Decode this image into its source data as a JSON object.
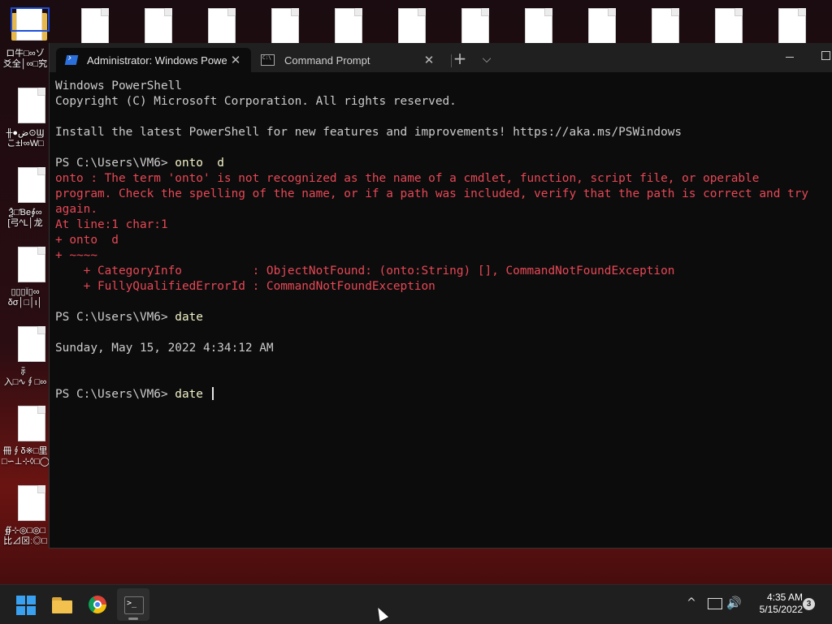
{
  "desktop": {
    "icons": [
      {
        "label_line1": "ロ牛□∞ゾ",
        "label_line2": "爻全│∞□究",
        "icon": "folder-icon"
      },
      {
        "label_line1": "╫●ض⊙Ϣ",
        "label_line2": "こ±ŀ∞W□",
        "icon": "file-icon"
      },
      {
        "label_line1": "Ѯ□Ɓе∮∞",
        "label_line2": "[弓^L│龙",
        "icon": "file-icon"
      },
      {
        "label_line1": "▯▯▯Ϊ▯∞",
        "label_line2": "δσ│□│ι│",
        "icon": "file-icon"
      },
      {
        "label_line1": "⺬",
        "label_line2": "入□∿∮□∞",
        "icon": "file-icon"
      },
      {
        "label_line1": "冊∮δ※□里",
        "label_line2": "□∽⊥⊹◊□◯",
        "icon": "file-icon"
      },
      {
        "label_line1": "∯⊹◎□◎□",
        "label_line2": "比⊿⊠ː◎□",
        "icon": "file-icon"
      }
    ]
  },
  "terminal": {
    "tabs": [
      {
        "title": "Administrator: Windows PowerShell",
        "icon": "powershell-icon",
        "active": true
      },
      {
        "title": "Command Prompt",
        "icon": "cmd-icon",
        "active": false
      }
    ],
    "close_glyph": "✕",
    "new_tab_glyph": "+",
    "dropdown_glyph": "⌵",
    "lines": [
      {
        "text": "Windows PowerShell",
        "style": "normal"
      },
      {
        "text": "Copyright (C) Microsoft Corporation. All rights reserved.",
        "style": "normal"
      },
      {
        "text": "",
        "style": "normal"
      },
      {
        "text": "Install the latest PowerShell for new features and improvements! https://aka.ms/PSWindows",
        "style": "normal"
      },
      {
        "text": "",
        "style": "normal"
      },
      {
        "prompt": "PS C:\\Users\\VM6> ",
        "command": "onto  d",
        "style": "prompt"
      },
      {
        "text": "onto : The term 'onto' is not recognized as the name of a cmdlet, function, script file, or operable",
        "style": "err"
      },
      {
        "text": "program. Check the spelling of the name, or if a path was included, verify that the path is correct and try",
        "style": "err"
      },
      {
        "text": "again.",
        "style": "err"
      },
      {
        "text": "At line:1 char:1",
        "style": "err"
      },
      {
        "text": "+ onto  d",
        "style": "err"
      },
      {
        "text": "+ ~~~~",
        "style": "err"
      },
      {
        "text": "    + CategoryInfo          : ObjectNotFound: (onto:String) [], CommandNotFoundException",
        "style": "err"
      },
      {
        "text": "    + FullyQualifiedErrorId : CommandNotFoundException",
        "style": "err"
      },
      {
        "text": "",
        "style": "normal"
      },
      {
        "prompt": "PS C:\\Users\\VM6> ",
        "command": "date",
        "style": "prompt"
      },
      {
        "text": "",
        "style": "normal"
      },
      {
        "text": "Sunday, May 15, 2022 4:34:12 AM",
        "style": "normal"
      },
      {
        "text": "",
        "style": "normal"
      },
      {
        "text": "",
        "style": "normal"
      },
      {
        "prompt": "PS C:\\Users\\VM6> ",
        "command": "date ",
        "style": "prompt",
        "cursor": true
      }
    ]
  },
  "taskbar": {
    "apps": [
      {
        "name": "start",
        "icon": "windows-logo-icon"
      },
      {
        "name": "file-explorer",
        "icon": "folder-icon"
      },
      {
        "name": "chrome",
        "icon": "chrome-icon"
      },
      {
        "name": "terminal",
        "icon": "terminal-icon",
        "active": true
      }
    ],
    "tray": {
      "chevron": "^",
      "volume_glyph": "🔊",
      "time": "4:35 AM",
      "date": "5/15/2022",
      "notification_count": "3"
    }
  }
}
